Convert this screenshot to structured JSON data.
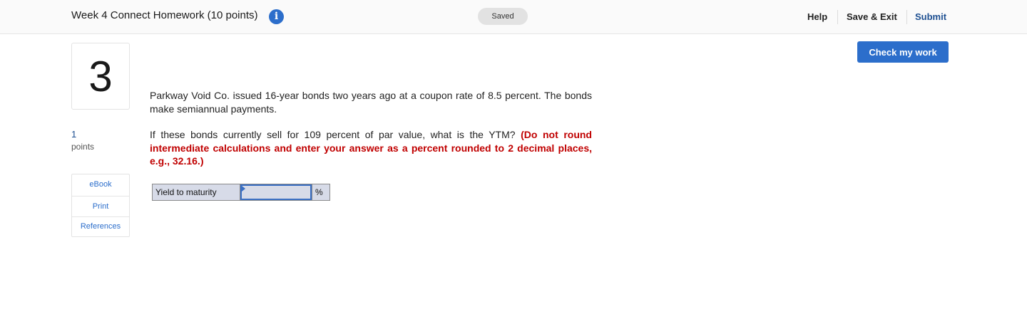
{
  "header": {
    "title": "Week 4 Connect Homework (10 points)",
    "info_icon": "info-icon",
    "status": "Saved",
    "links": {
      "help": "Help",
      "save_exit": "Save & Exit",
      "submit": "Submit"
    }
  },
  "question": {
    "number": "3",
    "points_value": "1",
    "points_label": "points",
    "check_button": "Check my work",
    "paragraph1": "Parkway Void Co. issued 16-year bonds two years ago at a coupon rate of 8.5 percent. The bonds make semiannual payments.",
    "paragraph2_main": "If these bonds currently sell for 109 percent of par value, what is the YTM?",
    "paragraph2_instruction": "(Do not round intermediate calculations and enter your answer as a percent rounded to 2 decimal places, e.g., 32.16.)"
  },
  "resources": {
    "ebook": "eBook",
    "print": "Print",
    "references": "References"
  },
  "answer": {
    "label": "Yield to maturity",
    "value": "",
    "unit": "%"
  },
  "colors": {
    "accent": "#2c6ecb",
    "submit_link": "#1d4f91",
    "instruction_red": "#c00000",
    "answer_cell_bg": "#d7dbe8"
  }
}
